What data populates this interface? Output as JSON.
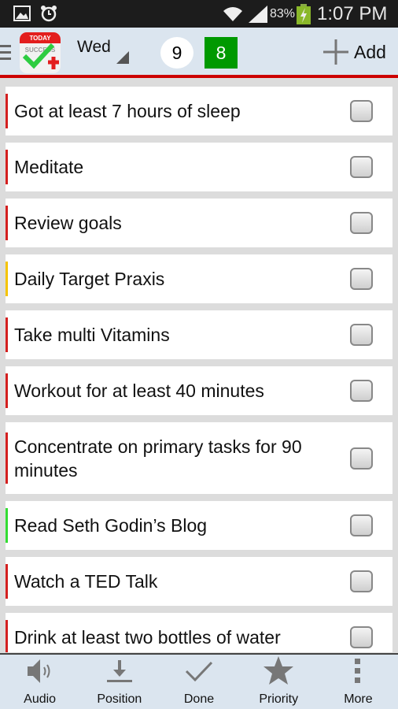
{
  "status_bar": {
    "battery": "83%",
    "time": "1:07 PM",
    "icons": [
      "image-icon",
      "alarm-icon",
      "wifi-icon",
      "signal-icon",
      "battery-charging-icon"
    ]
  },
  "header": {
    "app_logo_text": "TODAY SUCCESS",
    "day": "Wed",
    "count_total": "9",
    "count_done": "8",
    "add_label": "Add",
    "accent": "#cc0000",
    "done_color": "#009900"
  },
  "tasks": [
    {
      "label": "Got at least 7 hours of sleep",
      "priority_color": "#d42020",
      "checked": false
    },
    {
      "label": "Meditate",
      "priority_color": "#d42020",
      "checked": false
    },
    {
      "label": "Review goals",
      "priority_color": "#d42020",
      "checked": false
    },
    {
      "label": "Daily Target Praxis",
      "priority_color": "#f5c400",
      "checked": false
    },
    {
      "label": "Take multi Vitamins",
      "priority_color": "#d42020",
      "checked": false
    },
    {
      "label": "Workout for at least 40  minutes",
      "priority_color": "#d42020",
      "checked": false
    },
    {
      "label": "Concentrate on primary tasks for 90 minutes",
      "priority_color": "#d42020",
      "checked": false
    },
    {
      "label": "Read Seth Godin’s Blog",
      "priority_color": "#33dd33",
      "checked": false
    },
    {
      "label": "Watch a TED Talk",
      "priority_color": "#d42020",
      "checked": false
    },
    {
      "label": "Drink at least two bottles of water",
      "priority_color": "#d42020",
      "checked": false
    }
  ],
  "bottom_bar": [
    {
      "label": "Audio",
      "icon": "speaker-icon"
    },
    {
      "label": "Position",
      "icon": "download-icon"
    },
    {
      "label": "Done",
      "icon": "check-icon"
    },
    {
      "label": "Priority",
      "icon": "star-icon"
    },
    {
      "label": "More",
      "icon": "more-vertical-icon"
    }
  ]
}
